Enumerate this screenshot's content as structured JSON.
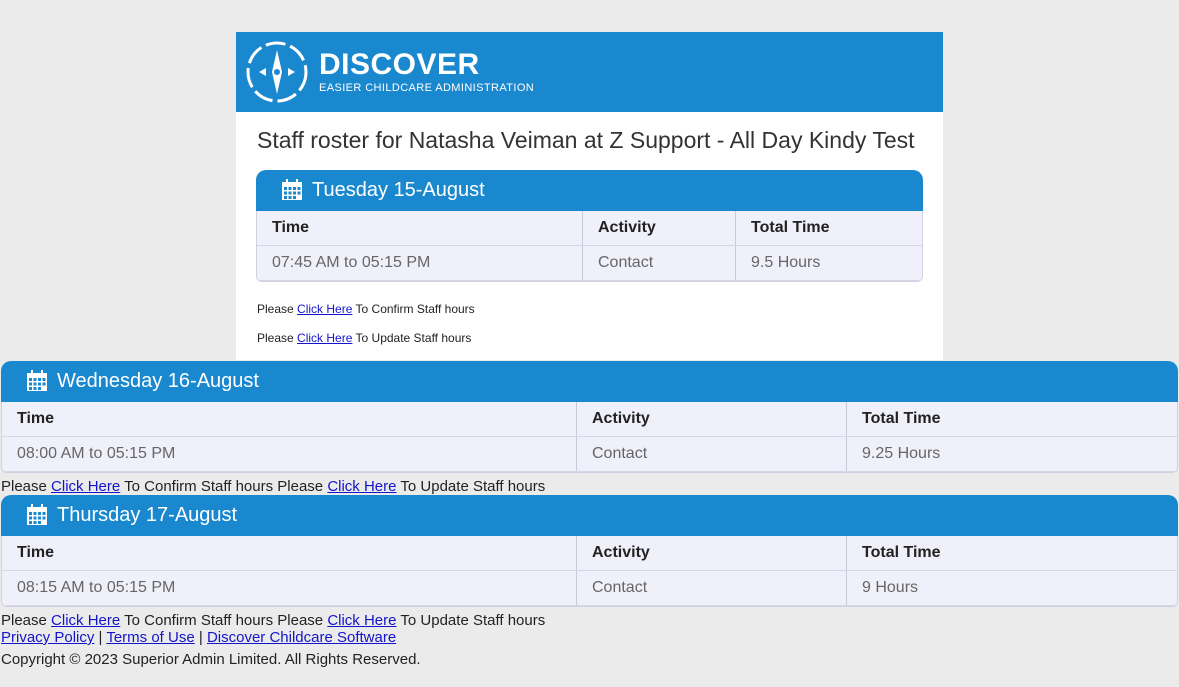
{
  "brand": {
    "name": "DISCOVER",
    "tagline": "EASIER CHILDCARE ADMINISTRATION"
  },
  "title": "Staff roster for Natasha Veiman at Z Support - All Day Kindy Test",
  "table_headers": {
    "time": "Time",
    "activity": "Activity",
    "total": "Total Time"
  },
  "days": [
    {
      "label": "Tuesday 15-August",
      "time": "07:45 AM to 05:15 PM",
      "activity": "Contact",
      "total": "9.5 Hours"
    },
    {
      "label": "Wednesday 16-August",
      "time": "08:00 AM to 05:15 PM",
      "activity": "Contact",
      "total": "9.25 Hours"
    },
    {
      "label": "Thursday 17-August",
      "time": "08:15 AM to 05:15 PM",
      "activity": "Contact",
      "total": "9 Hours"
    }
  ],
  "notes": {
    "please": "Please",
    "click_here": "Click Here",
    "confirm_suffix": "To Confirm Staff hours",
    "update_suffix": "To Update Staff hours"
  },
  "footer": {
    "privacy": "Privacy Policy",
    "sep": "|",
    "terms": "Terms of Use",
    "software": "Discover Childcare Software",
    "copyright": "Copyright © 2023 Superior Admin Limited. All Rights Reserved."
  },
  "colors": {
    "brand_blue": "#1a88cf",
    "link": "#1414cc",
    "table_bg": "#f0f0fb"
  }
}
